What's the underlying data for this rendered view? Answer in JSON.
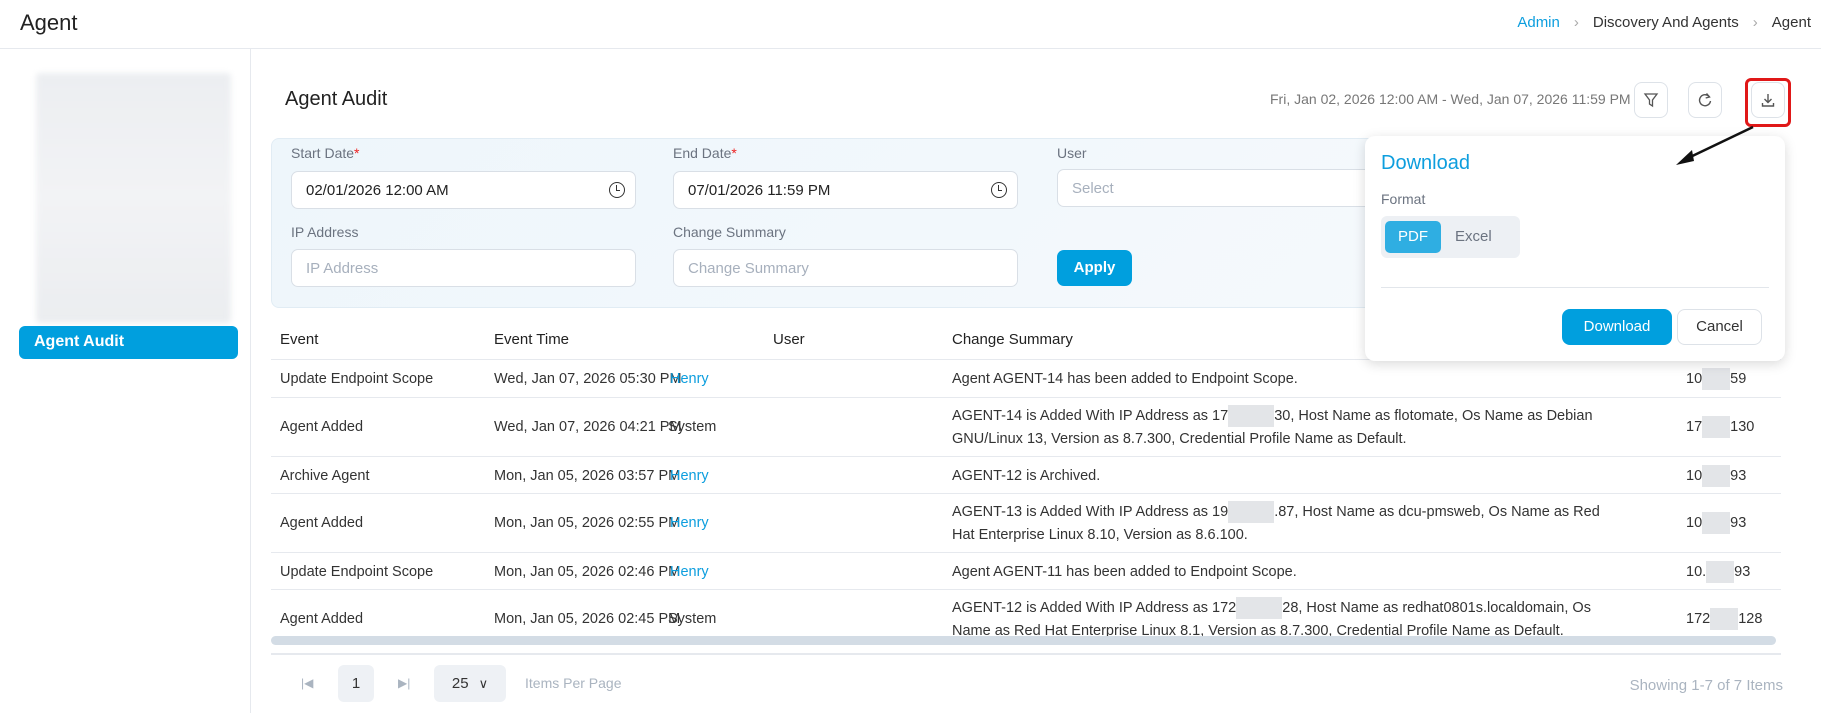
{
  "header": {
    "title": "Agent",
    "breadcrumb": [
      "Admin",
      "Discovery And Agents",
      "Agent"
    ]
  },
  "sidebar": {
    "active_item": "Agent Audit"
  },
  "main": {
    "title": "Agent Audit",
    "date_range": "Fri, Jan 02, 2026 12:00 AM - Wed, Jan 07, 2026 11:59 PM",
    "toolbar": {
      "filter_icon": "filter-icon",
      "refresh_icon": "refresh-icon",
      "download_icon": "download-icon"
    }
  },
  "filters": {
    "start_date": {
      "label": "Start Date",
      "required": "*",
      "value": "02/01/2026 12:00 AM"
    },
    "end_date": {
      "label": "End Date",
      "required": "*",
      "value": "07/01/2026 11:59 PM"
    },
    "user": {
      "label": "User",
      "placeholder": "Select"
    },
    "ip_address": {
      "label": "IP Address",
      "placeholder": "IP Address"
    },
    "change_summary": {
      "label": "Change Summary",
      "placeholder": "Change Summary"
    },
    "apply_label": "Apply"
  },
  "table": {
    "columns": [
      "Event",
      "Event Time",
      "User",
      "Change Summary"
    ],
    "rows": [
      {
        "event": "Update Endpoint Scope",
        "time": "Wed, Jan 07, 2026 05:30 PM",
        "user": "Henry",
        "user_link": true,
        "summary_a": "Agent AGENT-14 has been added to Endpoint Scope.",
        "summary_b": "",
        "ip_a": "10",
        "ip_b": "59"
      },
      {
        "event": "Agent Added",
        "time": "Wed, Jan 07, 2026 04:21 PM",
        "user": "System",
        "user_link": false,
        "summary_a": "AGENT-14 is Added With IP Address as 17",
        "summary_b": "30, Host Name as flotomate, Os Name as Debian GNU/Linux 13, Version as 8.7.300, Credential Profile Name as Default.",
        "ip_a": "17",
        "ip_b": "130"
      },
      {
        "event": "Archive Agent",
        "time": "Mon, Jan 05, 2026 03:57 PM",
        "user": "Henry",
        "user_link": true,
        "summary_a": "AGENT-12 is Archived.",
        "summary_b": "",
        "ip_a": "10",
        "ip_b": "93"
      },
      {
        "event": "Agent Added",
        "time": "Mon, Jan 05, 2026 02:55 PM",
        "user": "Henry",
        "user_link": true,
        "summary_a": "AGENT-13 is Added With IP Address as 19",
        "summary_b": ".87, Host Name as dcu-pmsweb, Os Name as Red Hat Enterprise Linux 8.10, Version as 8.6.100.",
        "ip_a": "10",
        "ip_b": "93"
      },
      {
        "event": "Update Endpoint Scope",
        "time": "Mon, Jan 05, 2026 02:46 PM",
        "user": "Henry",
        "user_link": true,
        "summary_a": "Agent AGENT-11 has been added to Endpoint Scope.",
        "summary_b": "",
        "ip_a": "10.",
        "ip_b": "93"
      },
      {
        "event": "Agent Added",
        "time": "Mon, Jan 05, 2026 02:45 PM",
        "user": "System",
        "user_link": false,
        "summary_a": "AGENT-12 is Added With IP Address as 172",
        "summary_b": "28, Host Name as redhat0801s.localdomain, Os Name as Red Hat Enterprise Linux 8.1, Version as 8.7.300, Credential Profile Name as Default.",
        "ip_a": "172",
        "ip_b": "128"
      }
    ]
  },
  "pagination": {
    "page": "1",
    "page_size": "25",
    "items_per_page_label": "Items Per Page",
    "showing": "Showing 1-7 of 7 Items"
  },
  "download_popup": {
    "title": "Download",
    "format_label": "Format",
    "formats": [
      "PDF",
      "Excel"
    ],
    "selected_format": "PDF",
    "download_label": "Download",
    "cancel_label": "Cancel"
  },
  "colors": {
    "accent": "#009fde",
    "highlight": "#e01818"
  }
}
